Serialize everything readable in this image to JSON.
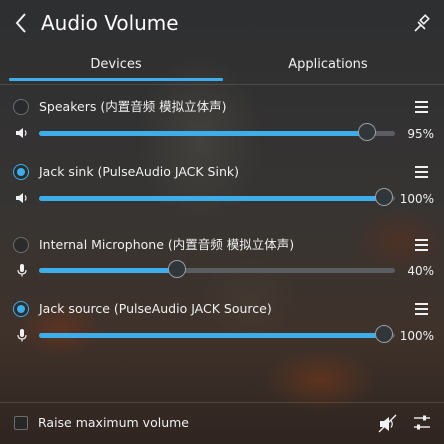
{
  "header": {
    "title": "Audio Volume",
    "back_icon": "chevron-left-icon",
    "pin_icon": "pin-icon"
  },
  "tabs": [
    {
      "label": "Devices",
      "active": true
    },
    {
      "label": "Applications",
      "active": false
    }
  ],
  "devices": [
    {
      "label": "Speakers (内置音频 模拟立体声)",
      "selected": false,
      "kind": "output",
      "volume": 95,
      "volume_text": "95%"
    },
    {
      "label": "Jack sink (PulseAudio JACK Sink)",
      "selected": true,
      "kind": "output",
      "volume": 100,
      "volume_text": "100%"
    },
    {
      "label": "Internal Microphone (内置音频 模拟立体声)",
      "selected": false,
      "kind": "input",
      "volume": 40,
      "volume_text": "40%"
    },
    {
      "label": "Jack source (PulseAudio JACK Source)",
      "selected": true,
      "kind": "input",
      "volume": 100,
      "volume_text": "100%"
    }
  ],
  "footer": {
    "raise_label": "Raise maximum volume",
    "raise_checked": false,
    "mute_icon": "speaker-muted-icon",
    "config_icon": "settings-sliders-icon"
  },
  "colors": {
    "accent": "#3daee9",
    "text": "#eff0f1",
    "track": "#5a5d61"
  }
}
